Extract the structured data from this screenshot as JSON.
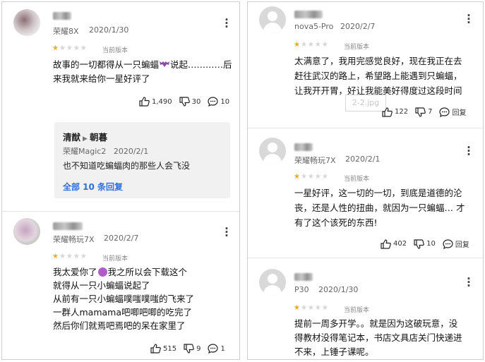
{
  "left": {
    "review1": {
      "device": "荣耀8X",
      "date": "2020/1/30",
      "version": "当前版本",
      "text_lines": [
        "故事的一切都得从一只蝙蝠",
        "说起…………后",
        "来我就来给你一星好评了"
      ],
      "likes": "1,490",
      "dislikes": "30",
      "replies": "10",
      "reply": {
        "from": "清猷",
        "to": "朝暮",
        "device": "荣耀Magic2",
        "date": "2020/2/1",
        "text": "也不知道吃蝙蝠肉的那些人会飞没",
        "link": "全部 10 条回复"
      }
    },
    "review2": {
      "device": "荣耀畅玩7X",
      "date": "2020/2/7",
      "version": "当前版本",
      "text_lines": [
        "我太爱你了",
        "我之所以会下载这个",
        "就得从一只小蝙蝠说起了",
        "从前有一只小蝙蝠噗嗤噗嗤的飞来了",
        "一群人mamama吧唧吧唧的吃完了",
        "然后你们就焉吧焉吧的呆在家里了"
      ],
      "likes": "515",
      "dislikes": "9",
      "replies": "1"
    }
  },
  "right": {
    "review1": {
      "device": "nova5-Pro",
      "date": "2020/2/7",
      "version": "当前版本",
      "text_lines": [
        "太满意了，我用完感觉良好，现在我正在去",
        "赶往武汉的路上，希望路上能遇到只蝙蝠，",
        "让我开开胃，好让我能美好得度过这段时间"
      ],
      "watermark": "2-2.jpg",
      "likes": "122",
      "dislikes": "7",
      "reply_label": "回复"
    },
    "review2": {
      "device": "荣耀畅玩7X",
      "date": "2020/2/1",
      "version": "当前版本",
      "text_lines": [
        "一星好评，这一切的一切，到底是道德的沦",
        "丧，还是人性的扭曲，就因为一只蝙蝠… 才",
        "有了这个该死的东西!"
      ],
      "likes": "402",
      "dislikes": "10",
      "reply_label": "回复"
    },
    "review3": {
      "device": "P30",
      "date": "2020/1/30",
      "version": "当前版本",
      "text_lines": [
        "提前一周多开学。。就是因为这破玩意，没",
        "得教材没得笔记本，书店文具店关门快递进",
        "不来，上锤子课呢。"
      ]
    }
  },
  "colors": {
    "star": "#f5a623",
    "star_off": "#d6d6d6",
    "link": "#2f6fdb",
    "reply_bg": "#f1f1f1"
  },
  "icons": [
    "thumbs-up-icon",
    "thumbs-down-icon",
    "comment-icon",
    "more-vert-icon",
    "star-icon",
    "chevron-right-icon"
  ]
}
